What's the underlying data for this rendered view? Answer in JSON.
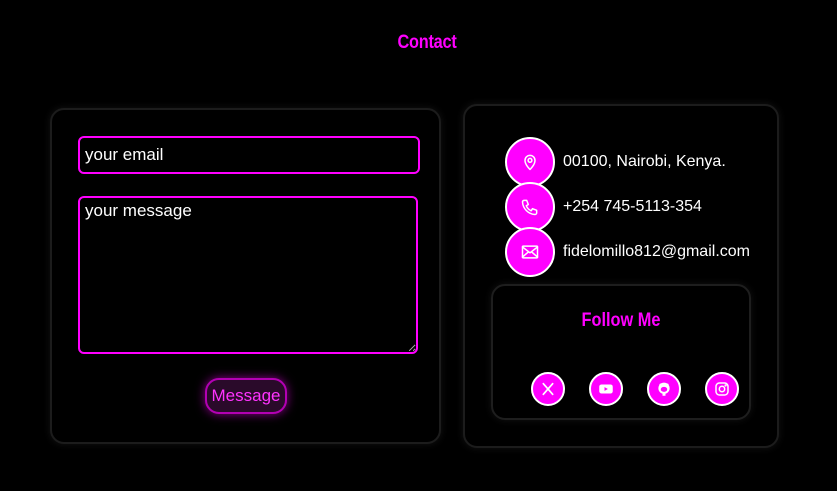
{
  "page": {
    "title": "Contact"
  },
  "form": {
    "email_placeholder": "your email",
    "message_placeholder": "your message",
    "submit_label": "Message"
  },
  "contact_info": {
    "items": [
      {
        "icon": "location-pin-icon",
        "text": "00100, Nairobi, Kenya."
      },
      {
        "icon": "phone-icon",
        "text": "+254 745-5113-354"
      },
      {
        "icon": "mail-icon",
        "text": "fidelomillo812@gmail.com"
      }
    ]
  },
  "follow": {
    "title": "Follow Me",
    "socials": [
      {
        "icon": "x-twitter-icon"
      },
      {
        "icon": "youtube-icon"
      },
      {
        "icon": "github-icon"
      },
      {
        "icon": "instagram-icon"
      }
    ]
  },
  "colors": {
    "accent": "#ff00ff",
    "background": "#000000",
    "text": "#ffffff"
  }
}
